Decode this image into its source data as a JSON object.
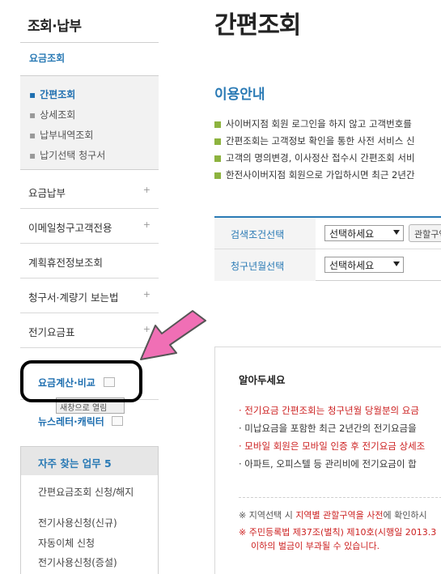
{
  "sidebar": {
    "title": "조회·납부",
    "section_title": "요금조회",
    "submenu": [
      {
        "label": "간편조회",
        "active": true
      },
      {
        "label": "상세조회",
        "active": false
      },
      {
        "label": "납부내역조회",
        "active": false
      },
      {
        "label": "납기선택 청구서",
        "active": false
      }
    ],
    "menu": [
      {
        "label": "요금납부",
        "plus": "+"
      },
      {
        "label": "이메일청구고객전용",
        "plus": "+"
      },
      {
        "label": "계획휴전정보조회",
        "plus": ""
      },
      {
        "label": "청구서·계량기 보는법",
        "plus": "+"
      },
      {
        "label": "전기요금표",
        "plus": "+"
      }
    ],
    "calc_label": "요금계산·비교",
    "tooltip": "새창으로 열림",
    "news_label": "뉴스레터·캐릭터",
    "freq_title": "자주 찾는 업무 5",
    "freq_items": [
      "간편요금조회 신청/해지",
      "전기사용신청(신규)",
      "자동이체 신청",
      "전기사용신청(증설)"
    ]
  },
  "main": {
    "page_title": "간편조회",
    "guide_title": "이용안내",
    "guide_items": [
      "사이버지점 회원 로그인을 하지 않고 고객번호를",
      "간편조회는 고객정보 확인을 통한 사전 서비스 신",
      "고객의 명의변경, 이사정산 접수시 간편조회 서비",
      "한전사이버지점 회원으로 가입하시면 최근 2년간"
    ],
    "search": {
      "row1_label": "검색조건선택",
      "row1_value": "선택하세요",
      "region_button": "관할구역",
      "row2_label": "청구년월선택",
      "row2_value": "선택하세요"
    },
    "notice": {
      "title": "알아두세요",
      "items": [
        {
          "text": "· 전기요금 간편조회는 청구년월 당월분의 요금",
          "style": "red"
        },
        {
          "text": "· 미납요금을 포함한 최근 2년간의 전기요금을",
          "style": "dark"
        },
        {
          "text": "· 모바일 회원은 모바일 인증 후 전기요금 상세조",
          "style": "red"
        },
        {
          "text": "· 아파트, 오피스텔 등 관리비에 전기요금이 합",
          "style": "dark"
        }
      ],
      "foot1_prefix": "※ 지역선택 시 ",
      "foot1_highlight": "지역별 관할구역을 사전",
      "foot1_suffix": "에 확인하시",
      "foot2_line1": "※ 주민등록법 제37조(벌칙) 제10호(시행일 2013.3",
      "foot2_line2": "이하의 벌금이 부과될 수 있습니다."
    }
  },
  "colors": {
    "accent_blue": "#2a7ab5",
    "notice_red": "#cc1f1f",
    "bullet_green": "#8db33f",
    "arrow_pink": "#f06fb5"
  }
}
